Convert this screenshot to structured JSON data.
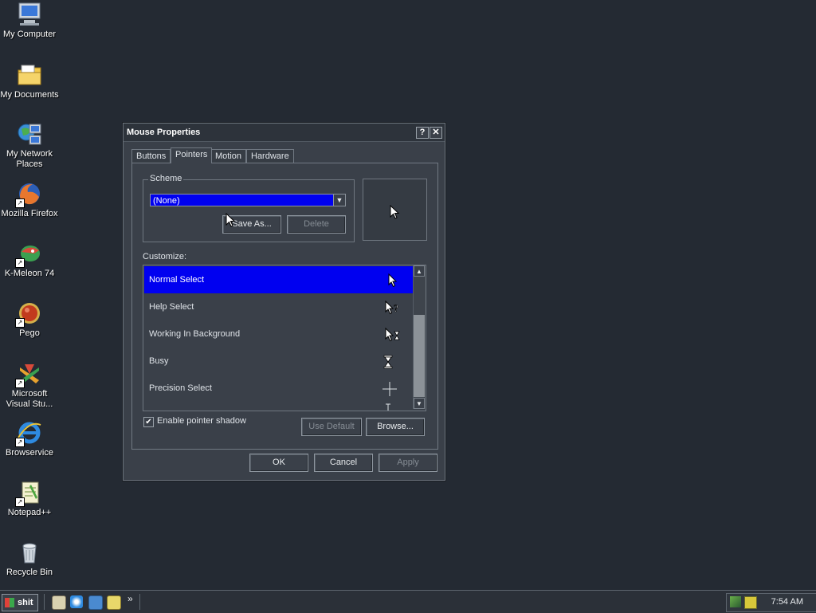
{
  "desktop": {
    "icons": [
      {
        "label": "My Computer",
        "icon": "my-computer-icon"
      },
      {
        "label": "My Documents",
        "icon": "my-documents-icon"
      },
      {
        "label": "My Network Places",
        "icon": "network-places-icon"
      },
      {
        "label": "Mozilla Firefox",
        "icon": "firefox-icon"
      },
      {
        "label": "K-Meleon 74",
        "icon": "k-meleon-icon"
      },
      {
        "label": "Pego",
        "icon": "pego-icon"
      },
      {
        "label": "Microsoft Visual Stu...",
        "icon": "visual-studio-icon"
      },
      {
        "label": "Browservice",
        "icon": "internet-explorer-icon"
      },
      {
        "label": "Notepad++",
        "icon": "notepad-plus-plus-icon"
      },
      {
        "label": "Recycle Bin",
        "icon": "recycle-bin-icon"
      }
    ]
  },
  "dialog": {
    "title": "Mouse Properties",
    "help_button": "?",
    "close_button": "✕",
    "tabs": [
      "Buttons",
      "Pointers",
      "Motion",
      "Hardware"
    ],
    "active_tab": "Pointers",
    "scheme": {
      "legend": "Scheme",
      "selected": "(None)",
      "save_as": "Save As...",
      "delete": "Delete"
    },
    "customize_label": "Customize:",
    "pointers": [
      {
        "name": "Normal Select",
        "icon": "arrow-cursor-icon"
      },
      {
        "name": "Help Select",
        "icon": "help-cursor-icon"
      },
      {
        "name": "Working In Background",
        "icon": "working-cursor-icon"
      },
      {
        "name": "Busy",
        "icon": "hourglass-cursor-icon"
      },
      {
        "name": "Precision Select",
        "icon": "crosshair-cursor-icon"
      }
    ],
    "enable_shadow_label": "Enable pointer shadow",
    "enable_shadow_checked": true,
    "use_default": "Use Default",
    "browse": "Browse...",
    "ok": "OK",
    "cancel": "Cancel",
    "apply": "Apply"
  },
  "taskbar": {
    "start_label": "shit",
    "chevron": "»",
    "clock": "7:54 AM"
  },
  "colors": {
    "desktop": "#242a33",
    "dialog": "#3a4049",
    "selection": "#0000f0"
  }
}
